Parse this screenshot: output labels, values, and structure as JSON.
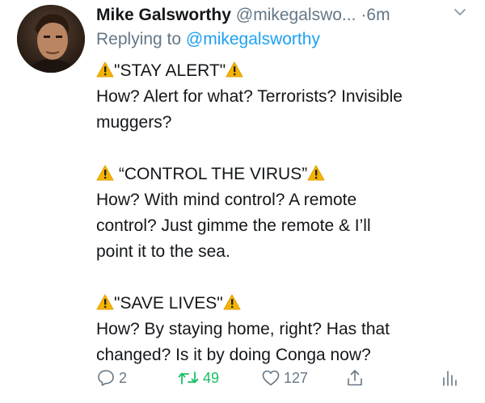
{
  "tweet": {
    "author_name": "Mike Galsworthy",
    "handle": "@mikegalswo...",
    "separator": "·",
    "time": "6m",
    "replying_prefix": "Replying to ",
    "replying_handle": "@mikegalsworthy",
    "paragraphs": [
      {
        "quote": "\"STAY ALERT\"",
        "text_lines": [
          "How? Alert for what? Terrorists? Invisible",
          "muggers?"
        ]
      },
      {
        "quote": "“CONTROL THE VIRUS”",
        "text_lines": [
          "How? With mind control? A remote",
          "control? Just gimme the remote & I’ll",
          "point it to the sea."
        ]
      },
      {
        "quote": "\"SAVE LIVES\"",
        "text_lines": [
          "How? By staying home, right? Has that",
          "changed? Is it by doing Conga now?"
        ]
      }
    ]
  },
  "actions": {
    "reply_count": "2",
    "retweet_count": "49",
    "like_count": "127"
  },
  "colors": {
    "text": "#14171a",
    "muted": "#657786",
    "link": "#1da1f2",
    "retweet": "#17bf63",
    "warning": "#f5b400"
  },
  "icons": [
    "chevron-down-icon",
    "warning-icon",
    "reply-icon",
    "retweet-icon",
    "like-icon",
    "share-icon",
    "analytics-icon"
  ]
}
